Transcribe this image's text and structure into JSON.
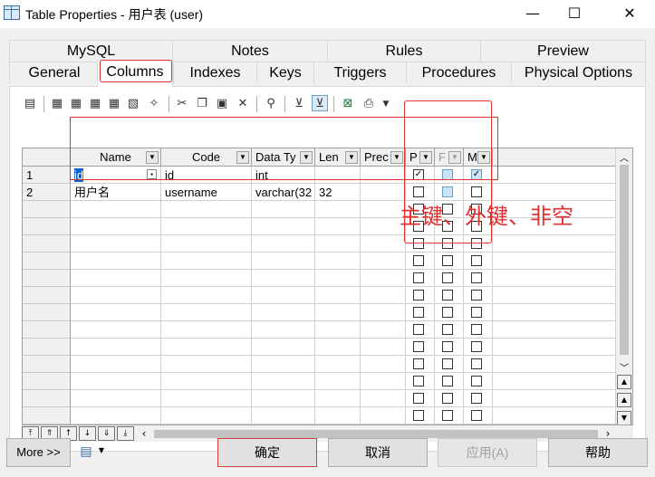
{
  "window": {
    "title": "Table Properties - 用户表 (user)",
    "minimize": "—",
    "maximize": "☐",
    "close": "✕"
  },
  "tabs_top": [
    "MySQL",
    "Notes",
    "Rules",
    "Preview"
  ],
  "tabs_bottom": [
    "General",
    "Columns",
    "Indexes",
    "Keys",
    "Triggers",
    "Procedures",
    "Physical Options"
  ],
  "grid": {
    "headers": [
      "Name",
      "Code",
      "Data Ty",
      "Len",
      "Prec",
      "P",
      "F",
      "M"
    ],
    "rows": [
      {
        "num": "1",
        "name": "id",
        "code": "id",
        "type": "int",
        "len": "",
        "p": true,
        "f": false,
        "m": true
      },
      {
        "num": "2",
        "name": "用户名",
        "code": "username",
        "type": "varchar(32",
        "len": "32",
        "p": false,
        "f": false,
        "m": false
      }
    ]
  },
  "annotation": "主键、外键、非空",
  "buttons": {
    "more": "More >>",
    "ok": "确定",
    "cancel": "取消",
    "apply": "应用(A)",
    "help": "帮助"
  },
  "colors": {
    "highlight_red": "#e03030",
    "checkbox_blue": "#cce4f7"
  }
}
